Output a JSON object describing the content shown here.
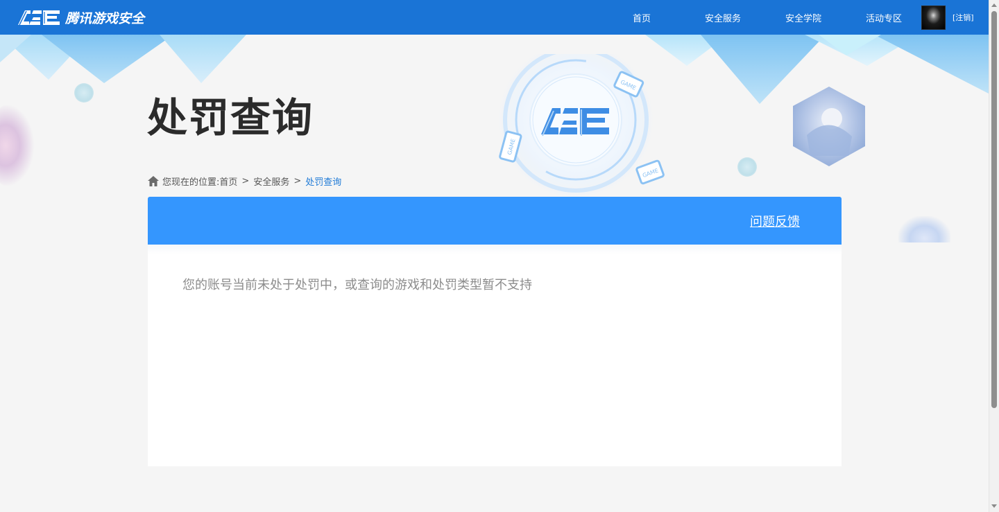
{
  "header": {
    "logo_mark": "ACE",
    "logo_text": "腾讯游戏安全",
    "nav": [
      "首页",
      "安全服务",
      "安全学院",
      "活动专区"
    ],
    "logout_label": "[注销]"
  },
  "hero": {
    "title": "处罚查询",
    "emblem_text": "ACE",
    "game_tag": "GAME"
  },
  "breadcrumb": {
    "prefix": "您现在的位置:",
    "items": [
      "首页",
      "安全服务",
      "处罚查询"
    ],
    "separator": ">"
  },
  "panel": {
    "feedback_label": "问题反馈",
    "empty_message": "您的账号当前未处于处罚中，或查询的游戏和处罚类型暂不支持"
  },
  "colors": {
    "topbar": "#1a74d6",
    "panel_header": "#3496fe",
    "breadcrumb_current": "#1f7ad6"
  }
}
